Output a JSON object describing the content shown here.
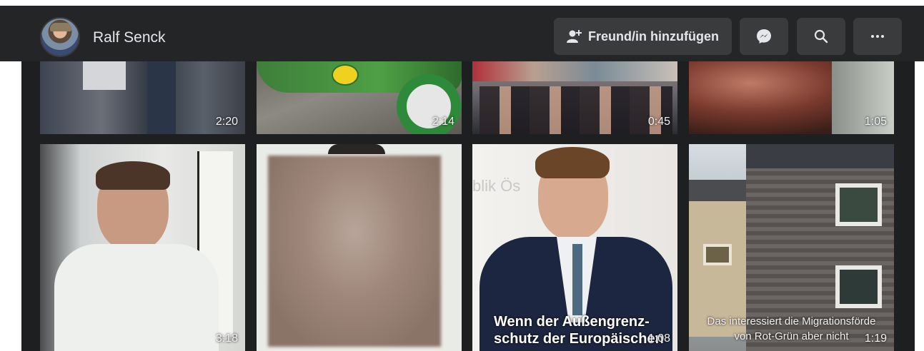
{
  "profile": {
    "name": "Ralf Senck"
  },
  "actions": {
    "add_friend_label": "Freund/in hinzufügen",
    "messenger_icon": "messenger-icon",
    "search_icon": "search-icon",
    "more_icon": "more-icon"
  },
  "videos_row1": [
    {
      "duration": "2:20"
    },
    {
      "duration": "2:14"
    },
    {
      "duration": "0:45"
    },
    {
      "duration": "1:05"
    }
  ],
  "videos_row2": [
    {
      "duration": "3:18"
    },
    {
      "duration": ""
    },
    {
      "duration": "1:08",
      "caption_line1": "Wenn der Außengrenz-",
      "caption_line2": "schutz der Europäischen",
      "bg_text": "blik Ös"
    },
    {
      "duration": "1:19",
      "caption_line1": "Das interessiert die Migrationsförde",
      "caption_line2": "von Rot-Grün aber nicht"
    }
  ]
}
